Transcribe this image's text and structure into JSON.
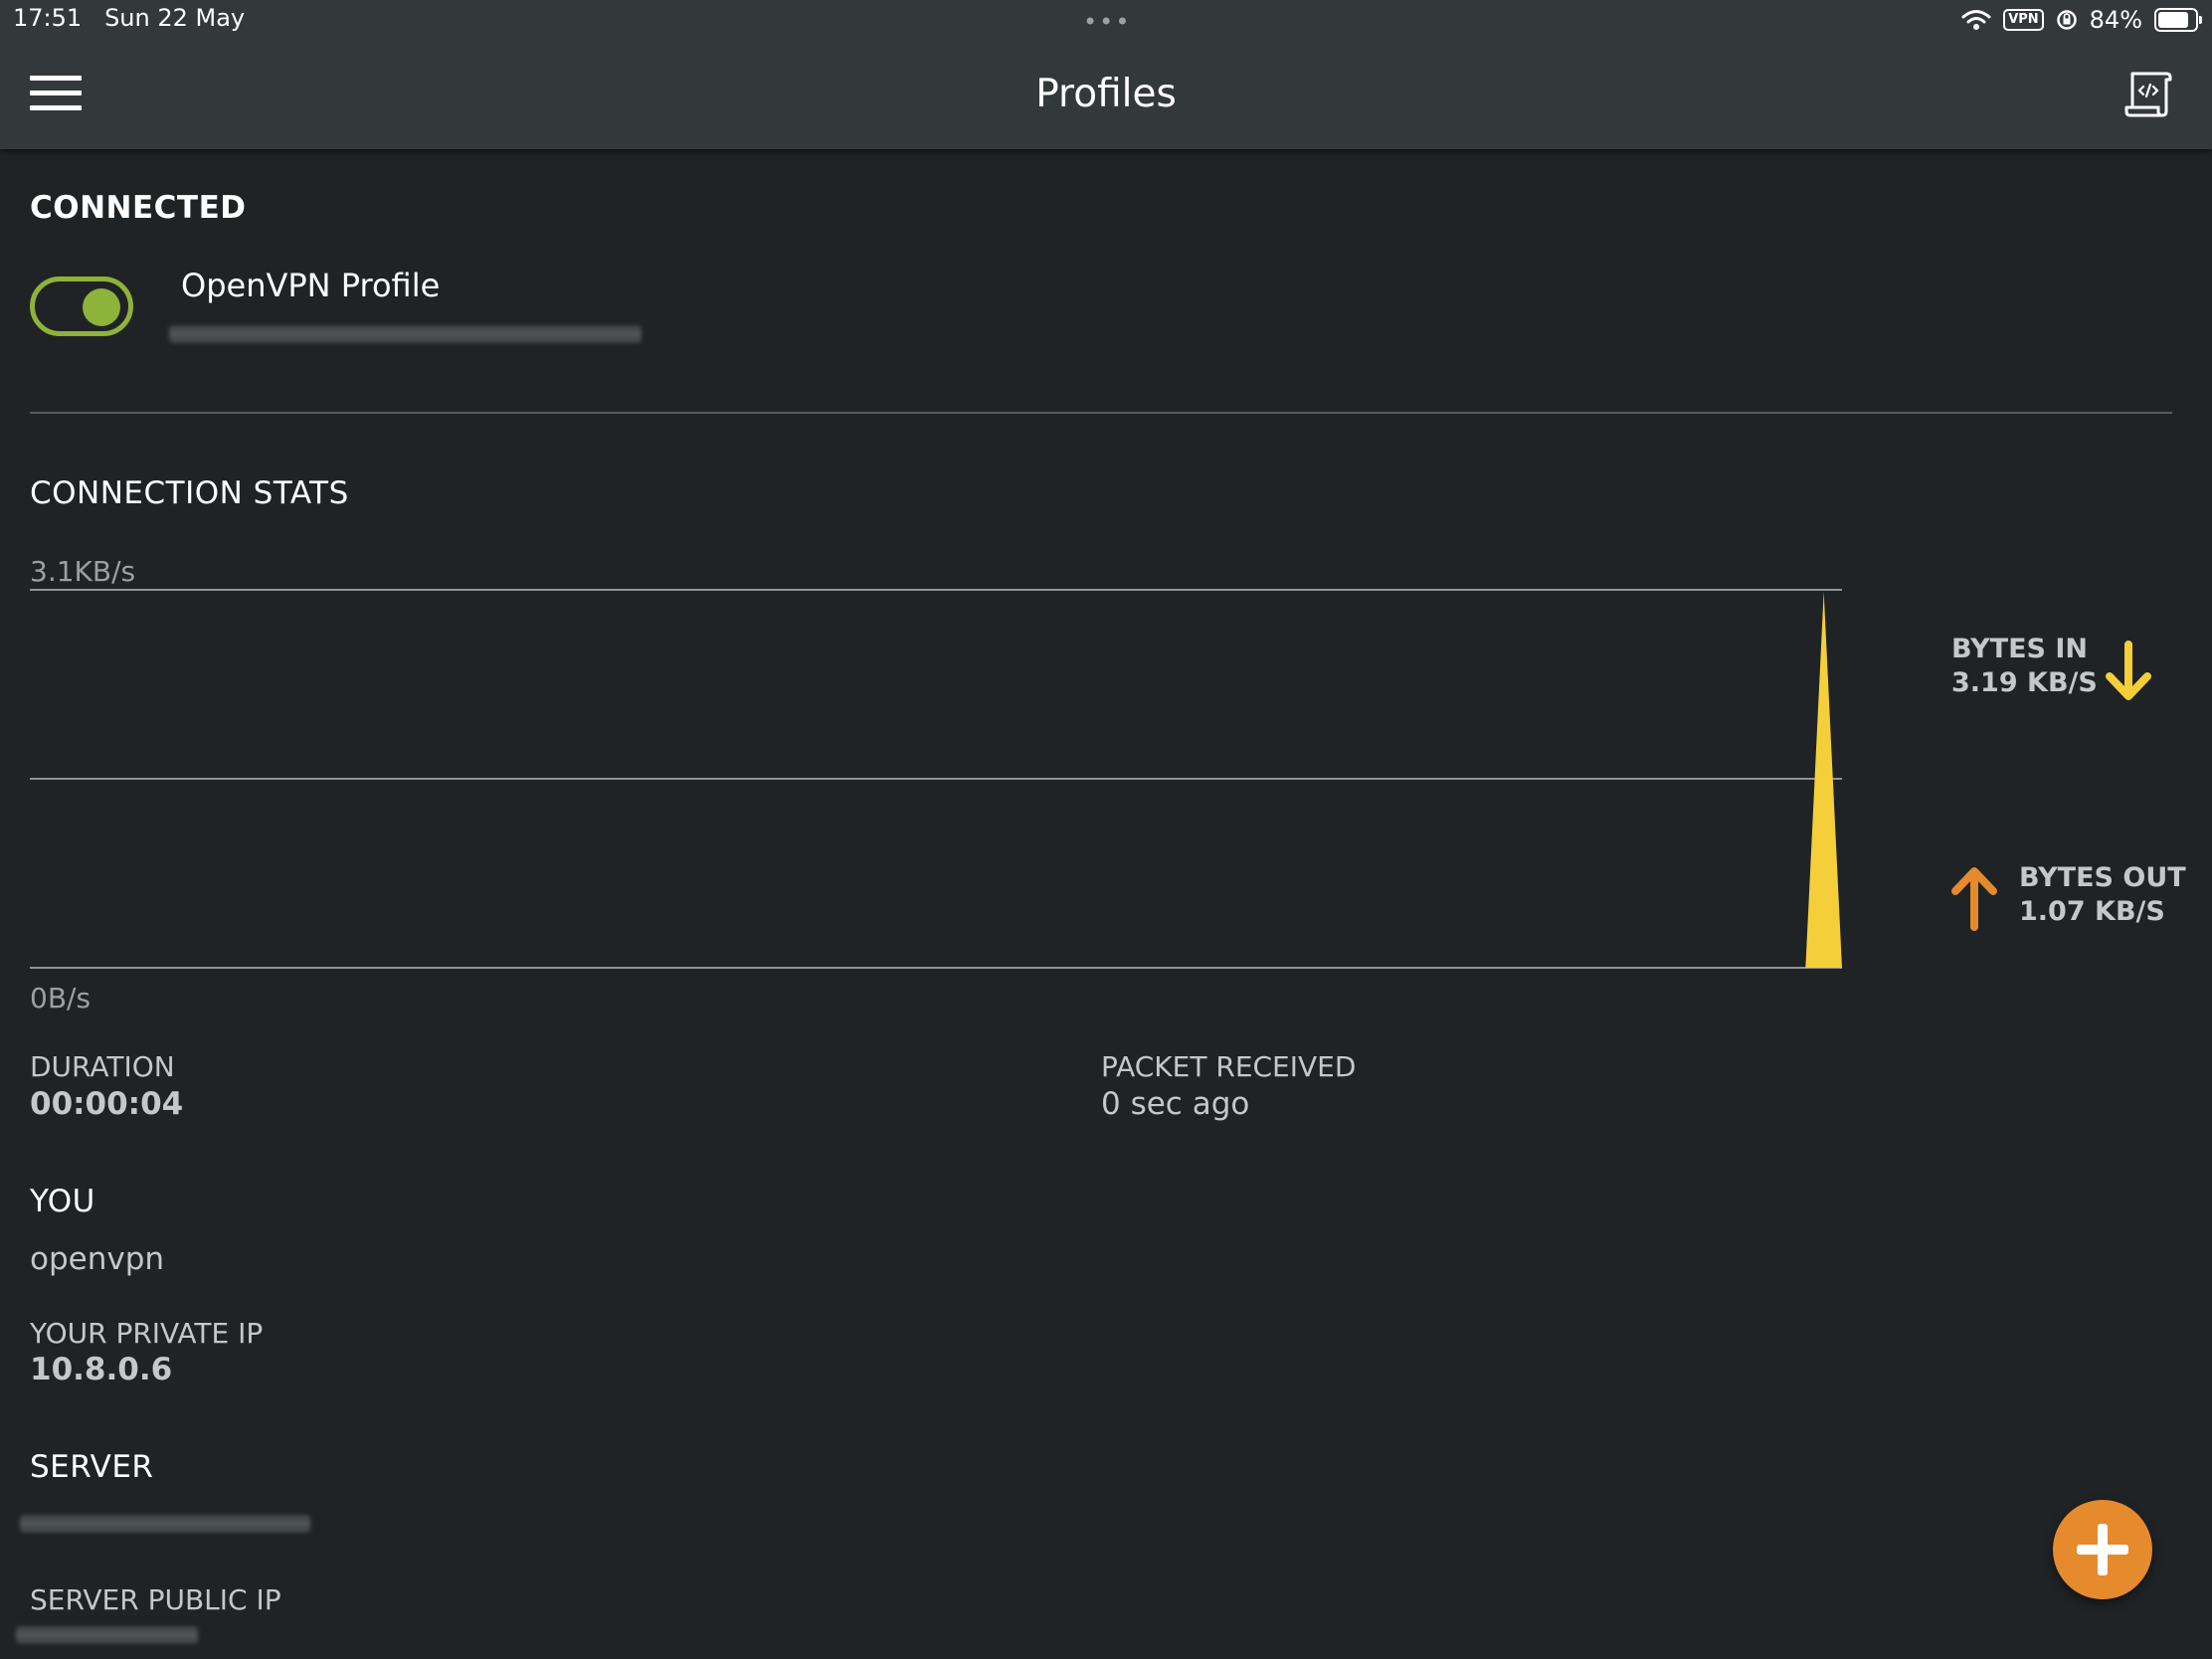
{
  "status_bar": {
    "time": "17:51",
    "date": "Sun 22 May",
    "dots": "•••",
    "vpn": "VPN",
    "battery": "84%",
    "battery_level": 0.84
  },
  "header": {
    "title": "Profiles"
  },
  "connected": {
    "heading": "CONNECTED",
    "profile_name": "OpenVPN Profile",
    "toggle_on": true
  },
  "stats": {
    "heading": "CONNECTION STATS",
    "bytes_in_label": "BYTES IN",
    "bytes_in_value": "3.19 KB/S",
    "bytes_out_label": "BYTES OUT",
    "bytes_out_value": "1.07 KB/S",
    "duration_label": "DURATION",
    "duration_value": "00:00:04",
    "packet_label": "PACKET RECEIVED",
    "packet_value": "0 sec ago"
  },
  "you": {
    "heading": "YOU",
    "username": "openvpn",
    "private_ip_label": "YOUR PRIVATE IP",
    "private_ip": "10.8.0.6"
  },
  "server": {
    "heading": "SERVER",
    "public_ip_label": "SERVER PUBLIC IP"
  },
  "colors": {
    "accent_green": "#8db33a",
    "bytes_in": "#f5cf3a",
    "bytes_out": "#e58a2d",
    "fab": "#e58a2d"
  },
  "chart_data": {
    "type": "area",
    "ylim": [
      0,
      3.1
    ],
    "y_unit": "KB/s",
    "y_max_label": "3.1KB/s",
    "y_min_label": "0B/s",
    "x": [
      0,
      1,
      2,
      3
    ],
    "series": [
      {
        "values": [
          0,
          0,
          3.1,
          0
        ]
      }
    ],
    "grid": true
  }
}
